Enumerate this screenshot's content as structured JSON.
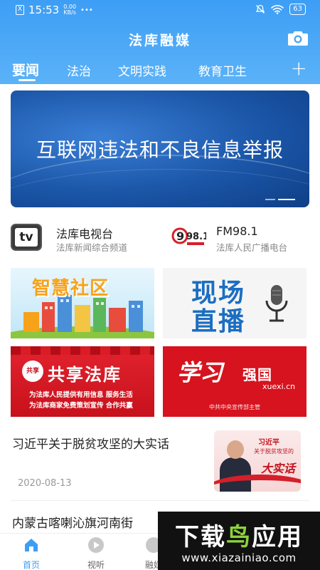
{
  "status_bar": {
    "sim": "X",
    "time": "15:53",
    "net_speed_value": "0.00",
    "net_speed_unit": "KB/s",
    "more": "•••",
    "battery": "63"
  },
  "header": {
    "title": "法库融媒",
    "camera_icon": "camera-icon"
  },
  "tabs": [
    {
      "label": "要闻",
      "active": true
    },
    {
      "label": "法治",
      "active": false
    },
    {
      "label": "文明实践",
      "active": false
    },
    {
      "label": "教育卫生",
      "active": false
    }
  ],
  "tab_add": "+",
  "banner": {
    "text": "互联网违法和不良信息举报",
    "slide_count": 2,
    "active_slide": 2
  },
  "channels": [
    {
      "name": "法库电视台",
      "desc": "法库新闻综合频道",
      "logo_text": "tv"
    },
    {
      "name": "FM98.1",
      "desc": "法库人民广播电台",
      "logo_text": "98.1"
    }
  ],
  "tiles": [
    {
      "title": "智慧社区"
    },
    {
      "title_line1": "现场",
      "title_line2": "直播"
    },
    {
      "seal": "共享",
      "title": "共享法库",
      "sub1": "为法库人民提供有用信息  服务生活",
      "sub2": "为法库商家免费策划宣传  合作共赢"
    },
    {
      "title_line1": "学习",
      "title_line2": "强国",
      "url": "xuexi.cn",
      "footer": "中共中央宣传部主管"
    }
  ],
  "news": [
    {
      "title": "习近平关于脱贫攻坚的大实话",
      "date": "2020-08-13",
      "thumb_line1": "习近平",
      "thumb_line2": "关于脱贫攻坚的",
      "thumb_line3": "大实话"
    },
    {
      "title": "内蒙古喀喇沁旗河南街"
    }
  ],
  "bottom_nav": [
    {
      "label": "首页",
      "icon": "home-icon",
      "active": true
    },
    {
      "label": "视听",
      "icon": "play-icon",
      "active": false
    },
    {
      "label": "融媒",
      "icon": "media-icon",
      "active": false
    }
  ],
  "watermark": {
    "line1_a": "下载",
    "line1_b": "鸟",
    "line1_c": "应用",
    "line2": "www.xiazainiao.com"
  },
  "colors": {
    "brand_blue": "#3d9ef5",
    "red": "#d6131e",
    "watermark_green": "#8dd13b"
  }
}
